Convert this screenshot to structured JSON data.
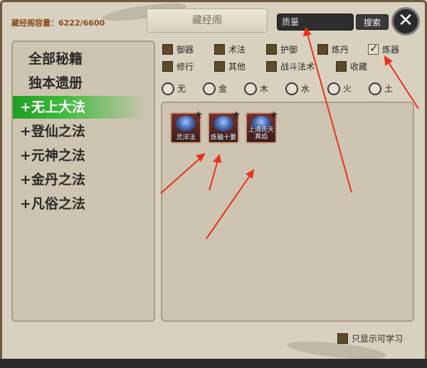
{
  "header": {
    "capacity": "藏经阁容量：6222/6600",
    "title": "藏经阁",
    "search_value": "质量",
    "search_button": "搜索",
    "close_symbol": "✕"
  },
  "sidebar": {
    "items": [
      {
        "label": "全部秘籍",
        "active": false
      },
      {
        "label": "独本遗册",
        "active": false
      },
      {
        "label": "+无上大法",
        "active": true
      },
      {
        "label": "+登仙之法",
        "active": false
      },
      {
        "label": "+元神之法",
        "active": false
      },
      {
        "label": "+金丹之法",
        "active": false
      },
      {
        "label": "+凡俗之法",
        "active": false
      }
    ]
  },
  "filters": {
    "type_checkboxes": [
      {
        "label": "御器",
        "checked": false
      },
      {
        "label": "术法",
        "checked": false
      },
      {
        "label": "护御",
        "checked": false
      },
      {
        "label": "炼丹",
        "checked": false
      },
      {
        "label": "炼器",
        "checked": true
      },
      {
        "label": "修行",
        "checked": false
      },
      {
        "label": "其他",
        "checked": false
      },
      {
        "label": "战斗法术",
        "checked": false
      },
      {
        "label": "收藏",
        "checked": false
      }
    ],
    "elements": [
      "无",
      "金",
      "木",
      "水",
      "火",
      "土"
    ]
  },
  "books": [
    {
      "label": "灵淬法"
    },
    {
      "label": "炼髓十要"
    },
    {
      "label": "上清先天真焰"
    }
  ],
  "footer": {
    "learnable_only": "只显示可学习"
  },
  "colors": {
    "active_green": "#1f9e22",
    "arrow_red": "#e8331c",
    "capacity_text": "#8a4f1c"
  }
}
